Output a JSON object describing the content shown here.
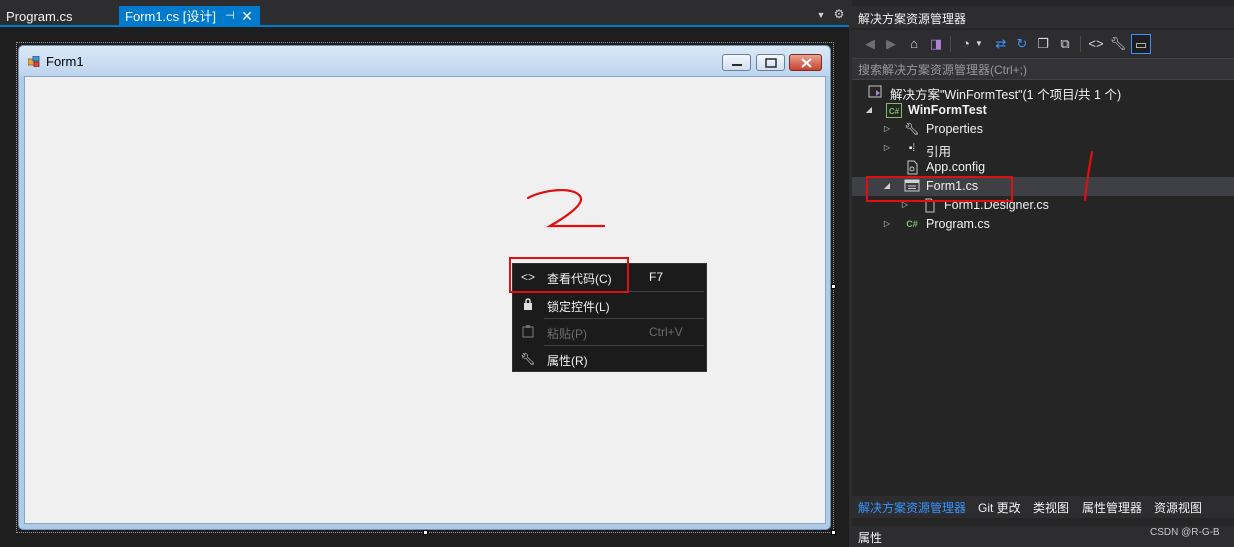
{
  "editor": {
    "tabs": [
      {
        "label": "Program.cs",
        "active": false
      },
      {
        "label": "Form1.cs [设计]",
        "active": true
      }
    ],
    "pin_glyph": "⊣",
    "close_glyph": "✕"
  },
  "form": {
    "title": "Form1"
  },
  "context_menu": {
    "items": [
      {
        "label": "查看代码(C)",
        "shortcut": "F7",
        "icon": "code-icon",
        "enabled": true
      },
      {
        "label": "锁定控件(L)",
        "shortcut": "",
        "icon": "lock-icon",
        "enabled": true
      },
      {
        "label": "粘贴(P)",
        "shortcut": "Ctrl+V",
        "icon": "paste-icon",
        "enabled": false
      },
      {
        "label": "属性(R)",
        "shortcut": "",
        "icon": "wrench-icon",
        "enabled": true
      }
    ]
  },
  "solution_explorer": {
    "title": "解决方案资源管理器",
    "search_placeholder": "搜索解决方案资源管理器(Ctrl+;)",
    "tree": [
      {
        "label": "解决方案\"WinFormTest\"(1 个项目/共 1 个)",
        "icon": "solution-icon",
        "bold": false
      },
      {
        "label": "WinFormTest",
        "icon": "csharp-project-icon",
        "bold": true
      },
      {
        "label": "Properties",
        "icon": "wrench-icon",
        "bold": false
      },
      {
        "label": "引用",
        "icon": "references-icon",
        "bold": false
      },
      {
        "label": "App.config",
        "icon": "config-file-icon",
        "bold": false
      },
      {
        "label": "Form1.cs",
        "icon": "form-file-icon",
        "bold": false,
        "selected": true
      },
      {
        "label": "Form1.Designer.cs",
        "icon": "file-icon",
        "bold": false
      },
      {
        "label": "Program.cs",
        "icon": "csharp-file-icon",
        "bold": false
      }
    ],
    "bottom_tabs": [
      "解决方案资源管理器",
      "Git 更改",
      "类视图",
      "属性管理器",
      "资源视图"
    ],
    "properties_title": "属性"
  },
  "annotations": {
    "step_1": "1",
    "step_2": "2"
  },
  "watermark": "CSDN @R-G-B",
  "colors": {
    "accent": "#007acc",
    "annotation": "#e01010",
    "panel_bg": "#252526",
    "form_client": "#f0f0f0"
  }
}
